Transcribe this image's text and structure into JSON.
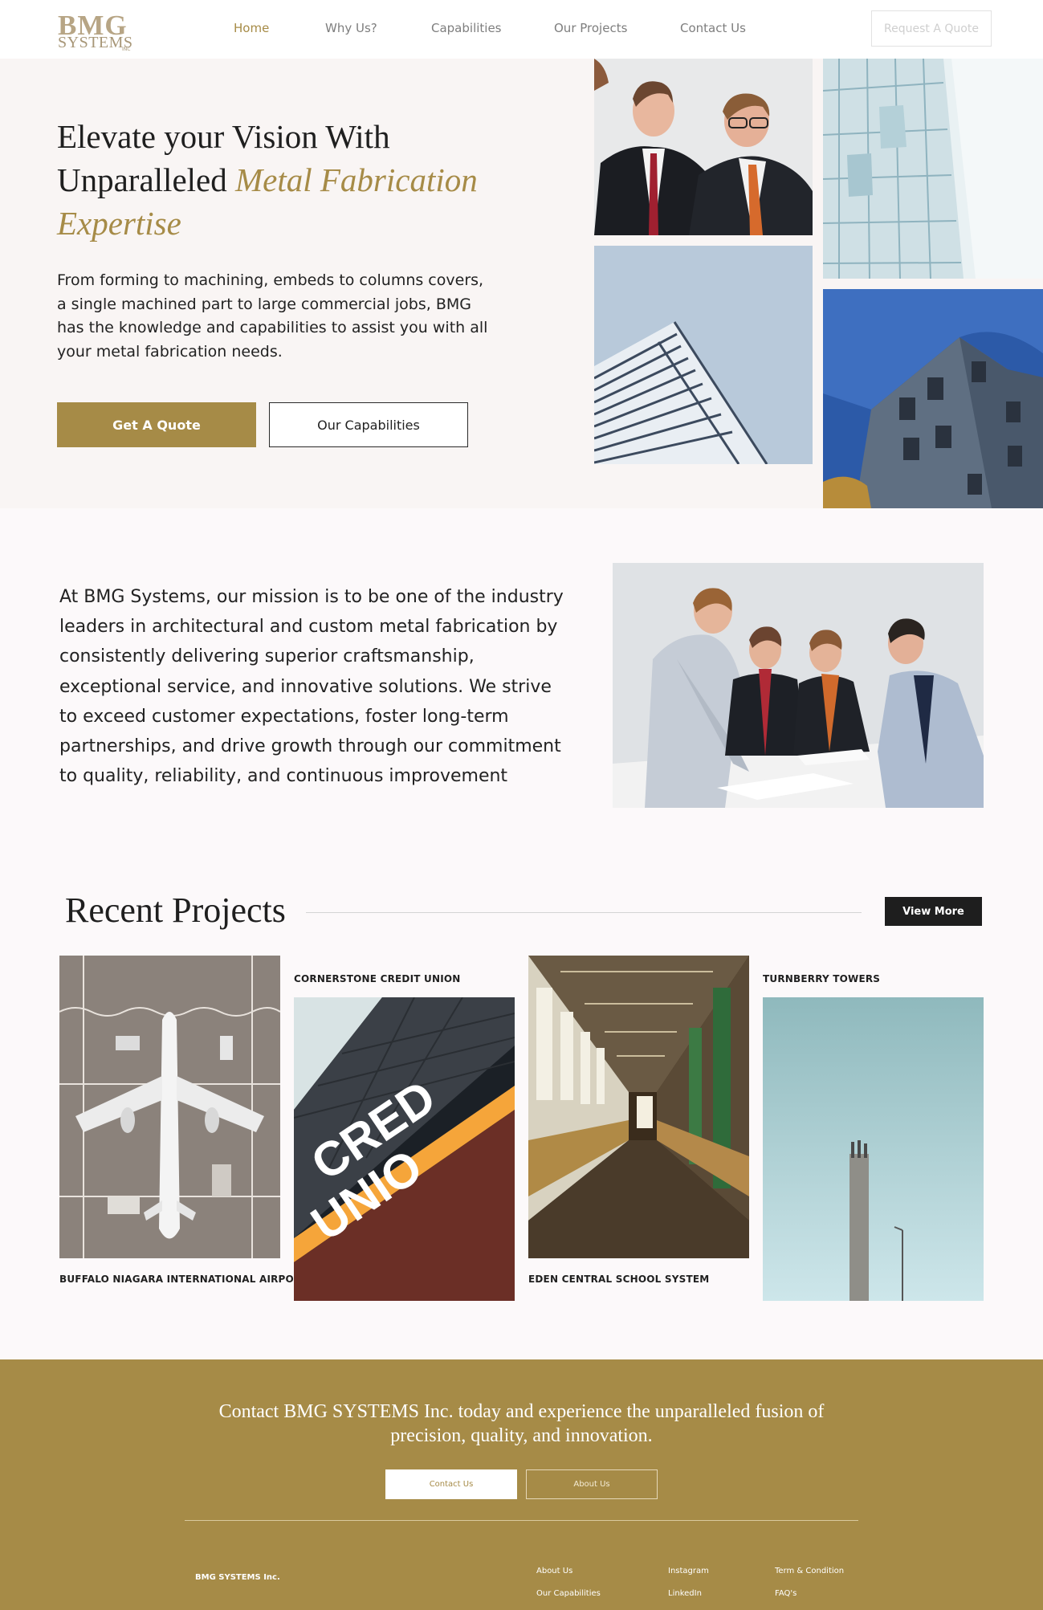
{
  "nav": {
    "logo_main": "BMG",
    "logo_sub": "SYSTEMS",
    "logo_inc": "INC",
    "links": [
      "Home",
      "Why Us?",
      "Capabilities",
      "Our Projects",
      "Contact Us"
    ],
    "request_quote": "Request A Quote"
  },
  "hero": {
    "title_line1": "Elevate your Vision With",
    "title_line2_plain": "Unparalleled ",
    "title_line2_gold": "Metal Fabrication",
    "title_line3_gold": "Expertise",
    "body": "From forming to machining, embeds to columns covers, a single machined part to large commercial jobs, BMG has the knowledge and capabilities to assist you with all your metal fabrication needs.",
    "cta_primary": "Get A Quote",
    "cta_secondary": "Our Capabilities"
  },
  "mission": {
    "text": "At BMG Systems, our mission is to be one of the industry leaders in architectural and custom metal fabrication by consistently delivering superior craftsmanship, exceptional service, and innovative solutions. We strive to exceed customer expectations, foster long-term partnerships, and drive growth through our commitment to quality, reliability, and continuous improvement"
  },
  "recent_projects": {
    "title": "Recent Projects",
    "view_more": "View More",
    "projects": [
      "BUFFALO NIAGARA INTERNATIONAL AIRPORT",
      "CORNERSTONE CREDIT UNION",
      "EDEN CENTRAL SCHOOL SYSTEM",
      "TURNBERRY TOWERS"
    ],
    "sign_text_1": "CRED",
    "sign_text_2": "UNIO"
  },
  "footer": {
    "headline": "Contact BMG SYSTEMS Inc. today and experience the unparalleled fusion of precision, quality, and innovation.",
    "btn_contact": "Contact Us",
    "btn_about": "About Us",
    "brand": "BMG SYSTEMS Inc.",
    "col1": [
      "About Us",
      "Our Capabilities"
    ],
    "col2": [
      "Instagram",
      "LinkedIn"
    ],
    "col3": [
      "Term & Condition",
      "FAQ's"
    ]
  },
  "colors": {
    "gold": "#a68b47",
    "dark": "#1e1e1e",
    "hero_bg": "#f9f5f4"
  }
}
